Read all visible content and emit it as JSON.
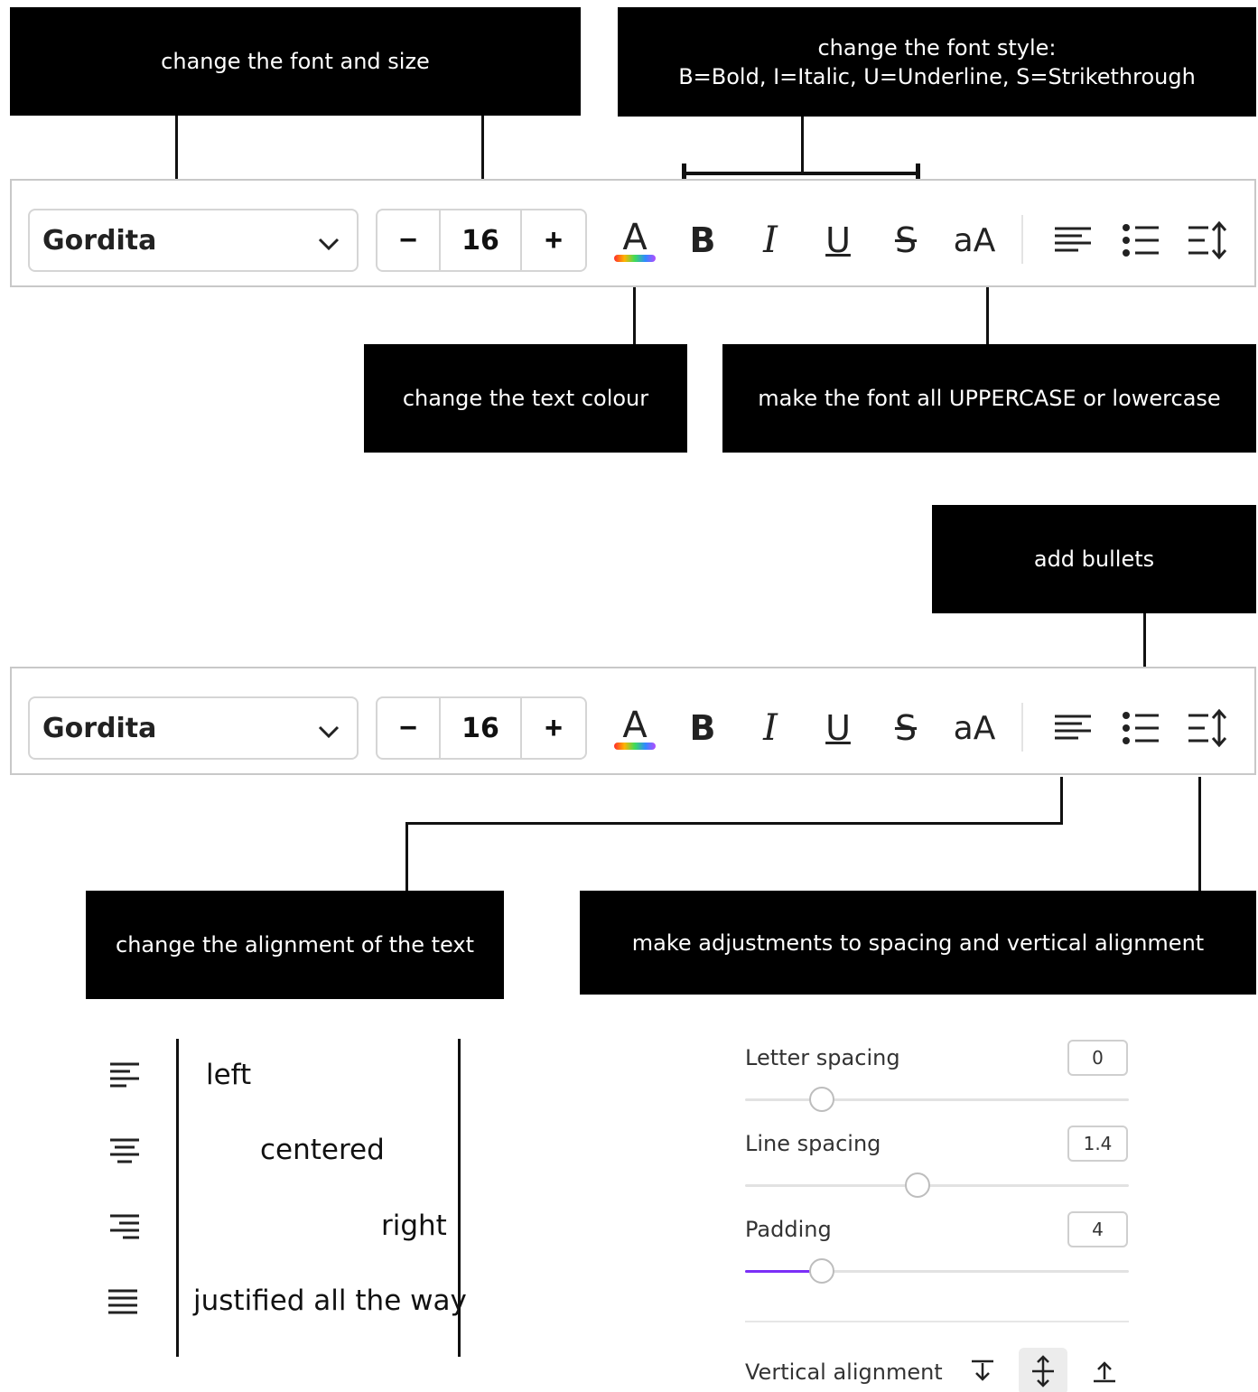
{
  "callouts": {
    "font_size": "change the font and size",
    "font_style": "change the font style:\nB=Bold, I=Italic, U=Underline, S=Strikethrough",
    "text_colour": "change the text colour",
    "case": "make the font all UPPERCASE or lowercase",
    "bullets": "add bullets",
    "alignment": "change the alignment of the text",
    "spacing": "make adjustments to spacing and vertical alignment"
  },
  "toolbar": {
    "font_name": "Gordita",
    "font_size": "16",
    "minus": "−",
    "plus": "+",
    "case_label": "aA",
    "icons": [
      "chevron-down-icon",
      "text-color-icon",
      "bold-icon",
      "italic-icon",
      "underline-icon",
      "strikethrough-icon",
      "case-icon",
      "align-left-icon",
      "bullet-list-icon",
      "spacing-icon"
    ]
  },
  "alignment_examples": {
    "left": "left",
    "centered": "centered",
    "right": "right",
    "justified": "justified all the way"
  },
  "spacing_panel": {
    "letter_spacing": {
      "label": "Letter spacing",
      "value": "0",
      "slider_fraction": 0.2
    },
    "line_spacing": {
      "label": "Line spacing",
      "value": "1.4",
      "slider_fraction": 0.45
    },
    "padding": {
      "label": "Padding",
      "value": "4",
      "slider_fraction": 0.2
    },
    "vertical_alignment": {
      "label": "Vertical alignment",
      "selected": "middle",
      "options": [
        "top",
        "middle",
        "bottom"
      ]
    }
  },
  "colors": {
    "accent": "#7b2ff7",
    "callout_bg": "#000000"
  }
}
